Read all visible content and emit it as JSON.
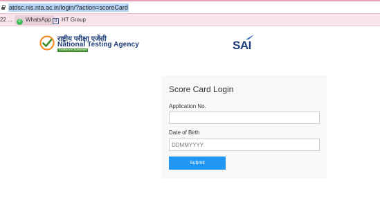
{
  "browser": {
    "url": "atdsc.nis.nta.ac.in/login/?action=scoreCard",
    "bookmarks": [
      {
        "label": "22 ..."
      },
      {
        "label": "WhatsApp",
        "icon": "whatsapp-icon"
      },
      {
        "label": "HT Group",
        "icon": "d-icon"
      }
    ]
  },
  "header": {
    "nta_hindi": "राष्ट्रीय परीक्षा एजेंसी",
    "nta_english": "National Testing Agency",
    "nta_tagline": "Excellence in Assessment",
    "sai_logo": "SAI"
  },
  "login": {
    "title": "Score Card Login",
    "application_label": "Application No.",
    "application_value": "",
    "dob_label": "Date of Birth",
    "dob_placeholder": "DDMMYYYY",
    "submit_label": "Submit"
  },
  "colors": {
    "accent": "#2196f3",
    "brand_blue": "#1f3d7a",
    "brand_green": "#3e8f2b",
    "brand_orange": "#f28c28",
    "card_background": "#f8f8f8"
  }
}
